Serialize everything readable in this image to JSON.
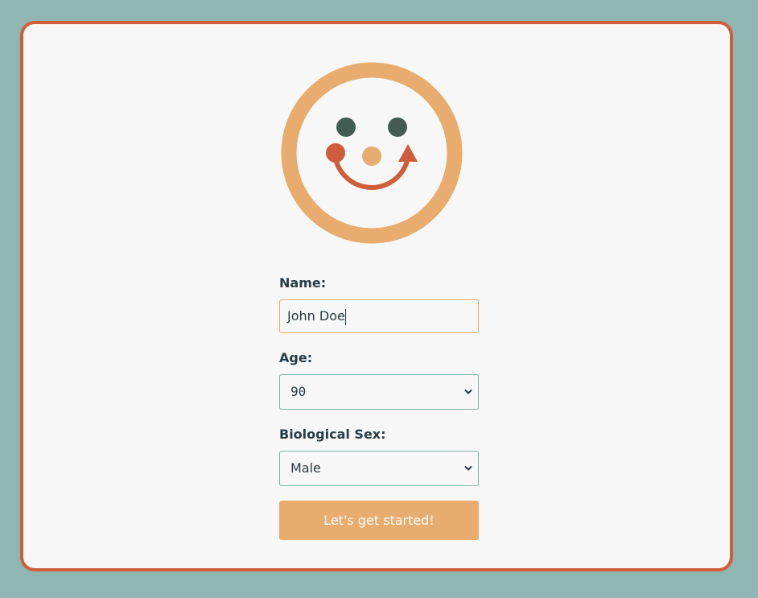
{
  "form": {
    "name_label": "Name:",
    "name_value": "John Doe",
    "age_label": "Age:",
    "age_value": "90",
    "sex_label": "Biological Sex:",
    "sex_value": "Male",
    "submit_label": "Let's get started!"
  },
  "colors": {
    "background": "#8fb6b2",
    "card": "#f6f7f6",
    "card_border": "#cf5d3b",
    "accent": "#e8ac6e",
    "eyes": "#445b54",
    "text": "#283c48"
  },
  "icons": {
    "logo": "smiley-face-icon",
    "select_arrow": "chevron-down-icon"
  }
}
